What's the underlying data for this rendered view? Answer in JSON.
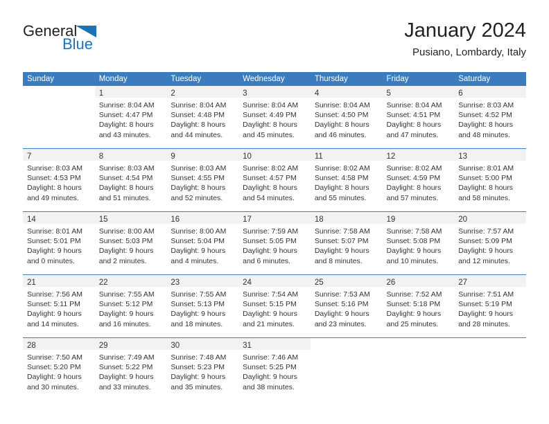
{
  "brand": {
    "name_part1": "General",
    "name_part2": "Blue",
    "primary_color": "#1c72b8",
    "header_color": "#3a7cbe"
  },
  "header": {
    "month_title": "January 2024",
    "location": "Pusiano, Lombardy, Italy"
  },
  "calendar": {
    "weekdays": [
      "Sunday",
      "Monday",
      "Tuesday",
      "Wednesday",
      "Thursday",
      "Friday",
      "Saturday"
    ],
    "weeks": [
      [
        {
          "day": "",
          "lines": []
        },
        {
          "day": "1",
          "lines": [
            "Sunrise: 8:04 AM",
            "Sunset: 4:47 PM",
            "Daylight: 8 hours",
            "and 43 minutes."
          ]
        },
        {
          "day": "2",
          "lines": [
            "Sunrise: 8:04 AM",
            "Sunset: 4:48 PM",
            "Daylight: 8 hours",
            "and 44 minutes."
          ]
        },
        {
          "day": "3",
          "lines": [
            "Sunrise: 8:04 AM",
            "Sunset: 4:49 PM",
            "Daylight: 8 hours",
            "and 45 minutes."
          ]
        },
        {
          "day": "4",
          "lines": [
            "Sunrise: 8:04 AM",
            "Sunset: 4:50 PM",
            "Daylight: 8 hours",
            "and 46 minutes."
          ]
        },
        {
          "day": "5",
          "lines": [
            "Sunrise: 8:04 AM",
            "Sunset: 4:51 PM",
            "Daylight: 8 hours",
            "and 47 minutes."
          ]
        },
        {
          "day": "6",
          "lines": [
            "Sunrise: 8:03 AM",
            "Sunset: 4:52 PM",
            "Daylight: 8 hours",
            "and 48 minutes."
          ]
        }
      ],
      [
        {
          "day": "7",
          "lines": [
            "Sunrise: 8:03 AM",
            "Sunset: 4:53 PM",
            "Daylight: 8 hours",
            "and 49 minutes."
          ]
        },
        {
          "day": "8",
          "lines": [
            "Sunrise: 8:03 AM",
            "Sunset: 4:54 PM",
            "Daylight: 8 hours",
            "and 51 minutes."
          ]
        },
        {
          "day": "9",
          "lines": [
            "Sunrise: 8:03 AM",
            "Sunset: 4:55 PM",
            "Daylight: 8 hours",
            "and 52 minutes."
          ]
        },
        {
          "day": "10",
          "lines": [
            "Sunrise: 8:02 AM",
            "Sunset: 4:57 PM",
            "Daylight: 8 hours",
            "and 54 minutes."
          ]
        },
        {
          "day": "11",
          "lines": [
            "Sunrise: 8:02 AM",
            "Sunset: 4:58 PM",
            "Daylight: 8 hours",
            "and 55 minutes."
          ]
        },
        {
          "day": "12",
          "lines": [
            "Sunrise: 8:02 AM",
            "Sunset: 4:59 PM",
            "Daylight: 8 hours",
            "and 57 minutes."
          ]
        },
        {
          "day": "13",
          "lines": [
            "Sunrise: 8:01 AM",
            "Sunset: 5:00 PM",
            "Daylight: 8 hours",
            "and 58 minutes."
          ]
        }
      ],
      [
        {
          "day": "14",
          "lines": [
            "Sunrise: 8:01 AM",
            "Sunset: 5:01 PM",
            "Daylight: 9 hours",
            "and 0 minutes."
          ]
        },
        {
          "day": "15",
          "lines": [
            "Sunrise: 8:00 AM",
            "Sunset: 5:03 PM",
            "Daylight: 9 hours",
            "and 2 minutes."
          ]
        },
        {
          "day": "16",
          "lines": [
            "Sunrise: 8:00 AM",
            "Sunset: 5:04 PM",
            "Daylight: 9 hours",
            "and 4 minutes."
          ]
        },
        {
          "day": "17",
          "lines": [
            "Sunrise: 7:59 AM",
            "Sunset: 5:05 PM",
            "Daylight: 9 hours",
            "and 6 minutes."
          ]
        },
        {
          "day": "18",
          "lines": [
            "Sunrise: 7:58 AM",
            "Sunset: 5:07 PM",
            "Daylight: 9 hours",
            "and 8 minutes."
          ]
        },
        {
          "day": "19",
          "lines": [
            "Sunrise: 7:58 AM",
            "Sunset: 5:08 PM",
            "Daylight: 9 hours",
            "and 10 minutes."
          ]
        },
        {
          "day": "20",
          "lines": [
            "Sunrise: 7:57 AM",
            "Sunset: 5:09 PM",
            "Daylight: 9 hours",
            "and 12 minutes."
          ]
        }
      ],
      [
        {
          "day": "21",
          "lines": [
            "Sunrise: 7:56 AM",
            "Sunset: 5:11 PM",
            "Daylight: 9 hours",
            "and 14 minutes."
          ]
        },
        {
          "day": "22",
          "lines": [
            "Sunrise: 7:55 AM",
            "Sunset: 5:12 PM",
            "Daylight: 9 hours",
            "and 16 minutes."
          ]
        },
        {
          "day": "23",
          "lines": [
            "Sunrise: 7:55 AM",
            "Sunset: 5:13 PM",
            "Daylight: 9 hours",
            "and 18 minutes."
          ]
        },
        {
          "day": "24",
          "lines": [
            "Sunrise: 7:54 AM",
            "Sunset: 5:15 PM",
            "Daylight: 9 hours",
            "and 21 minutes."
          ]
        },
        {
          "day": "25",
          "lines": [
            "Sunrise: 7:53 AM",
            "Sunset: 5:16 PM",
            "Daylight: 9 hours",
            "and 23 minutes."
          ]
        },
        {
          "day": "26",
          "lines": [
            "Sunrise: 7:52 AM",
            "Sunset: 5:18 PM",
            "Daylight: 9 hours",
            "and 25 minutes."
          ]
        },
        {
          "day": "27",
          "lines": [
            "Sunrise: 7:51 AM",
            "Sunset: 5:19 PM",
            "Daylight: 9 hours",
            "and 28 minutes."
          ]
        }
      ],
      [
        {
          "day": "28",
          "lines": [
            "Sunrise: 7:50 AM",
            "Sunset: 5:20 PM",
            "Daylight: 9 hours",
            "and 30 minutes."
          ]
        },
        {
          "day": "29",
          "lines": [
            "Sunrise: 7:49 AM",
            "Sunset: 5:22 PM",
            "Daylight: 9 hours",
            "and 33 minutes."
          ]
        },
        {
          "day": "30",
          "lines": [
            "Sunrise: 7:48 AM",
            "Sunset: 5:23 PM",
            "Daylight: 9 hours",
            "and 35 minutes."
          ]
        },
        {
          "day": "31",
          "lines": [
            "Sunrise: 7:46 AM",
            "Sunset: 5:25 PM",
            "Daylight: 9 hours",
            "and 38 minutes."
          ]
        },
        {
          "day": "",
          "lines": []
        },
        {
          "day": "",
          "lines": []
        },
        {
          "day": "",
          "lines": []
        }
      ]
    ]
  }
}
